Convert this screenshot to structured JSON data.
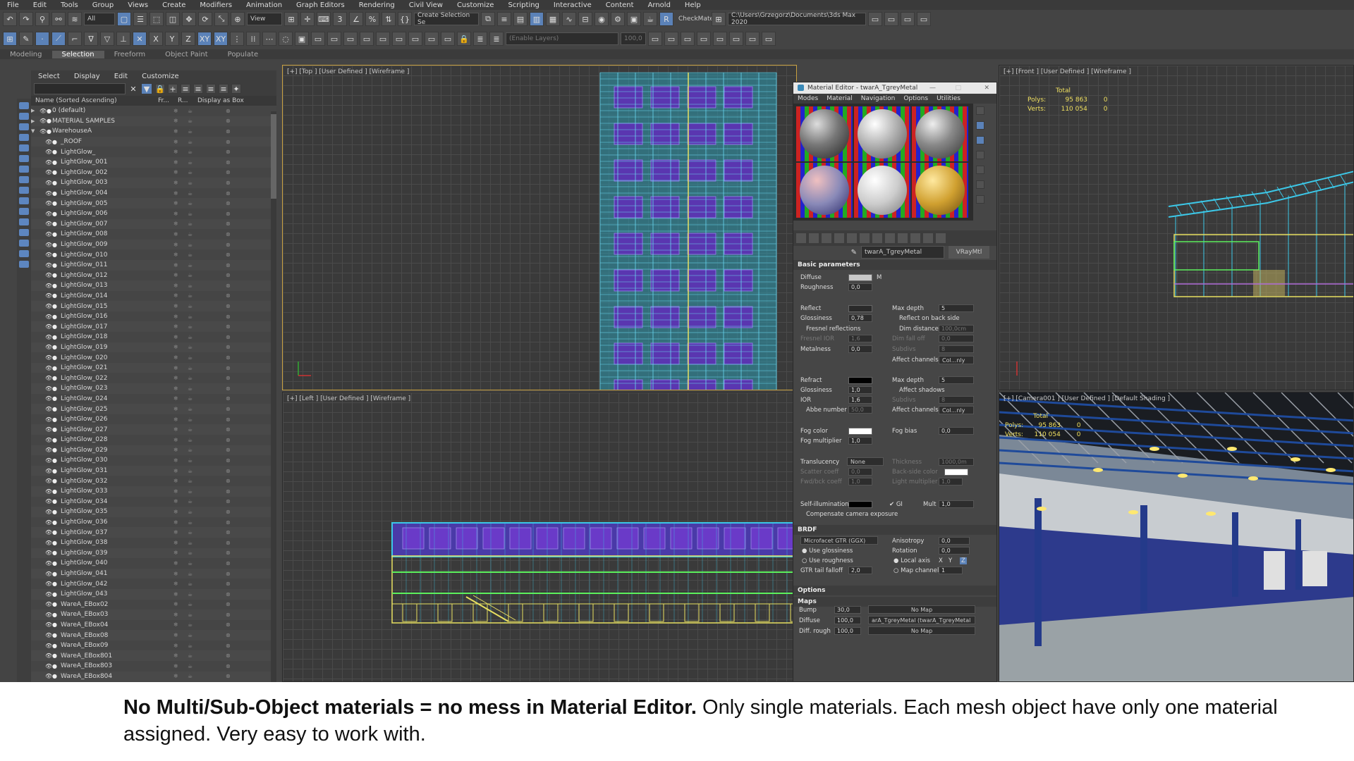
{
  "menu": [
    "File",
    "Edit",
    "Tools",
    "Group",
    "Views",
    "Create",
    "Modifiers",
    "Animation",
    "Graph Editors",
    "Rendering",
    "Civil View",
    "Customize",
    "Scripting",
    "Interactive",
    "Content",
    "Arnold",
    "Help"
  ],
  "toolbar1": {
    "filter": "All",
    "view": "View",
    "selection_set": "Create Selection Se",
    "checkmate": "CheckMate",
    "path": "C:\\Users\\Grzegorz\\Documents\\3ds Max 2020"
  },
  "toolbar2": {
    "layers": "(Enable Layers)",
    "percent": "100,0"
  },
  "ribbon_tabs": [
    "Modeling",
    "Selection",
    "Freeform",
    "Object Paint",
    "Populate"
  ],
  "scene_explorer": {
    "menu": [
      "Select",
      "Display",
      "Edit",
      "Customize"
    ],
    "columns": [
      "Name (Sorted Ascending)",
      "Fr...",
      "R...",
      "Display as Box"
    ],
    "rows": [
      "0 (default)",
      "MATERIAL SAMPLES",
      "WarehouseA",
      "_ROOF",
      "LightGlow_",
      "LightGlow_001",
      "LightGlow_002",
      "LightGlow_003",
      "LightGlow_004",
      "LightGlow_005",
      "LightGlow_006",
      "LightGlow_007",
      "LightGlow_008",
      "LightGlow_009",
      "LightGlow_010",
      "LightGlow_011",
      "LightGlow_012",
      "LightGlow_013",
      "LightGlow_014",
      "LightGlow_015",
      "LightGlow_016",
      "LightGlow_017",
      "LightGlow_018",
      "LightGlow_019",
      "LightGlow_020",
      "LightGlow_021",
      "LightGlow_022",
      "LightGlow_023",
      "LightGlow_024",
      "LightGlow_025",
      "LightGlow_026",
      "LightGlow_027",
      "LightGlow_028",
      "LightGlow_029",
      "LightGlow_030",
      "LightGlow_031",
      "LightGlow_032",
      "LightGlow_033",
      "LightGlow_034",
      "LightGlow_035",
      "LightGlow_036",
      "LightGlow_037",
      "LightGlow_038",
      "LightGlow_039",
      "LightGlow_040",
      "LightGlow_041",
      "LightGlow_042",
      "LightGlow_043",
      "WareA_EBox02",
      "WareA_EBox03",
      "WareA_EBox04",
      "WareA_EBox08",
      "WareA_EBox09",
      "WareA_EBox801",
      "WareA_EBox803",
      "WareA_EBox804"
    ]
  },
  "viewports": {
    "top": "[+] [Top ] [User Defined ] [Wireframe ]",
    "left": "[+] [Left ] [User Defined ] [Wireframe ]",
    "front": "[+] [Front ] [User Defined ] [Wireframe ]",
    "camera": "[+] [Camera001 ] [User Defined ] [Default Shading ]"
  },
  "stats": {
    "total": "Total",
    "polys_label": "Polys:",
    "polys": "95 863",
    "polys_sel": "0",
    "verts_label": "Verts:",
    "verts": "110 054",
    "verts_sel": "0"
  },
  "material_editor": {
    "title": "Material Editor - twarA_TgreyMetal",
    "menu": [
      "Modes",
      "Material",
      "Navigation",
      "Options",
      "Utilities"
    ],
    "material_name": "twarA_TgreyMetal",
    "material_type": "VRayMtl",
    "basic": "Basic parameters",
    "diffuse": "Diffuse",
    "m": "M",
    "roughness": "Roughness",
    "roughness_val": "0,0",
    "reflect": "Reflect",
    "glossiness": "Glossiness",
    "refl_gloss": "0,78",
    "fresnel": "Fresnel reflections",
    "fresnel_ior": "Fresnel IOR",
    "fresnel_ior_val": "1,6",
    "metalness": "Metalness",
    "metalness_val": "0,0",
    "max_depth": "Max depth",
    "max_depth_val": "5",
    "reflect_back": "Reflect on back side",
    "dim_distance": "Dim distance",
    "dim_distance_val": "100,0cm",
    "dim_falloff": "Dim fall off",
    "dim_falloff_val": "0,0",
    "subdivs": "Subdivs",
    "subdivs_val": "8",
    "affect_channels": "Affect channels",
    "affect_val": "Col...nly",
    "refract": "Refract",
    "refr_gloss": "1,0",
    "ior": "IOR",
    "ior_val": "1,6",
    "abbe": "Abbe number",
    "abbe_val": "50,0",
    "affect_shadows": "Affect shadows",
    "fog_color": "Fog color",
    "fog_bias": "Fog bias",
    "fog_bias_val": "0,0",
    "fog_mult": "Fog multiplier",
    "fog_mult_val": "1,0",
    "translucency": "Translucency",
    "transl_val": "None",
    "thickness": "Thickness",
    "thickness_val": "1000,0m",
    "scatter": "Scatter coeff",
    "scatter_val": "0,0",
    "backside": "Back-side color",
    "fwdbck": "Fwd/bck coeff",
    "fwdbck_val": "1,0",
    "light_mult": "Light multiplier",
    "light_mult_val": "1,0",
    "self_illum": "Self-illumination",
    "gi": "GI",
    "mult": "Mult",
    "mult_val": "1,0",
    "compensate": "Compensate camera exposure",
    "brdf": "BRDF",
    "brdf_type": "Microfacet GTR (GGX)",
    "anisotropy": "Anisotropy",
    "aniso_val": "0,0",
    "rotation": "Rotation",
    "rotation_val": "0,0",
    "use_gloss": "Use glossiness",
    "use_rough": "Use roughness",
    "local_axis": "Local axis",
    "x": "X",
    "y": "Y",
    "z": "Z",
    "gtr": "GTR tail falloff",
    "gtr_val": "2,0",
    "map_channel": "Map channel",
    "map_channel_val": "1",
    "options": "Options",
    "maps": "Maps",
    "bump": "Bump",
    "bump_val": "30,0",
    "bump_map": "No Map",
    "diffuse_map_label": "Diffuse",
    "diffuse_map_val": "100,0",
    "diffuse_map": "arA_TgreyMetal (twarA_TgreyMetal",
    "diff_rough": "Diff. rough",
    "diff_rough_val": "100,0",
    "diff_rough_map": "No Map"
  },
  "caption": {
    "bold": "No Multi/Sub-Object materials = no mess in Material Editor.",
    "normal": " Only single materials. Each mesh object have only one material assigned. Very easy to work with."
  }
}
